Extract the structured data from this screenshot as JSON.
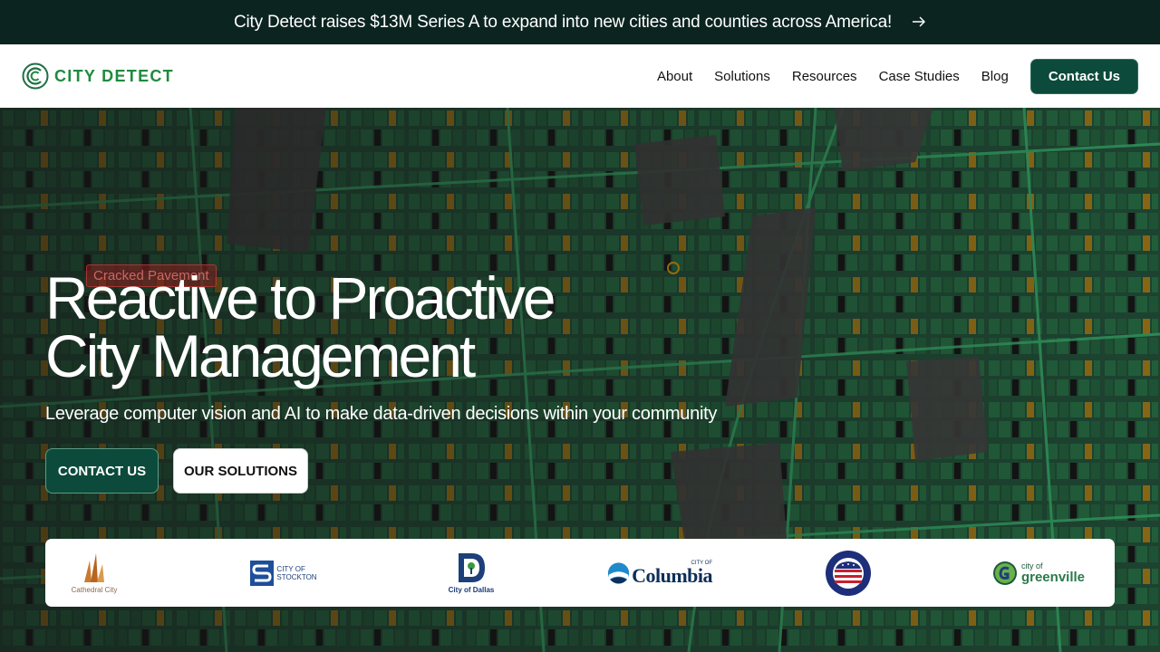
{
  "announcement": {
    "text": "City Detect raises $13M Series A to expand into new cities and counties across America!",
    "arrow_icon": "arrow-right-icon"
  },
  "nav": {
    "brand": "CITY DETECT",
    "links": [
      "About",
      "Solutions",
      "Resources",
      "Case Studies",
      "Blog"
    ],
    "cta": "Contact Us"
  },
  "hero": {
    "map_tag": "Cracked Pavement",
    "title_line1": "Reactive to Proactive",
    "title_line2": "City Management",
    "subtitle": "Leverage computer vision and AI to make data-driven decisions within your community",
    "primary_button": "CONTACT US",
    "secondary_button": "OUR SOLUTIONS"
  },
  "clients": {
    "cathedral": "Cathedral City",
    "stockton_top": "CITY OF",
    "stockton_bottom": "STOCKTON",
    "dallas": "City of Dallas",
    "columbia_top": "CITY OF",
    "columbia": "Columbia",
    "cleveland": "CITY OF CLEVELAND, OHIO",
    "greenville_top": "city of",
    "greenville": "greenville"
  },
  "colors": {
    "announcement_bg": "#0b2420",
    "brand_green": "#1f8a3e",
    "cta_bg": "#0c4a3b",
    "map_green": "#1f6e43",
    "map_dark": "#1c1c1c",
    "map_orange": "#b9870f"
  }
}
